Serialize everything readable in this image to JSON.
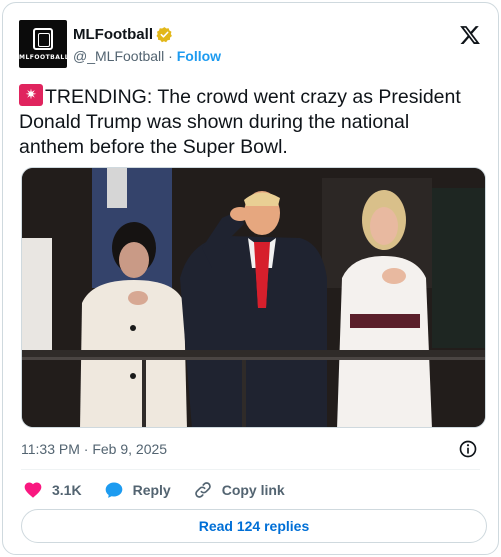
{
  "author": {
    "display_name": "MLFootball",
    "handle": "@_MLFootball",
    "separator": "·",
    "follow_label": "Follow",
    "avatar_text": "MLFOOTBALL",
    "verified_color": "#e2b719"
  },
  "tweet": {
    "text": "TRENDING: The crowd went crazy as President Donald Trump was shown during the national anthem before the Super Bowl.",
    "leading_emoji": "rotating-light-emoji",
    "timestamp": "11:33 PM · Feb 9, 2025"
  },
  "actions": {
    "likes_count": "3.1K",
    "reply_label": "Reply",
    "copy_link_label": "Copy link",
    "read_replies_label": "Read 124 replies"
  },
  "colors": {
    "accent": "#1d9bf0",
    "like": "#f91880",
    "secondary_text": "#536471"
  },
  "icons": [
    "x-logo-icon",
    "verified-badge-icon",
    "info-icon",
    "heart-icon",
    "reply-bubble-icon",
    "link-icon"
  ]
}
